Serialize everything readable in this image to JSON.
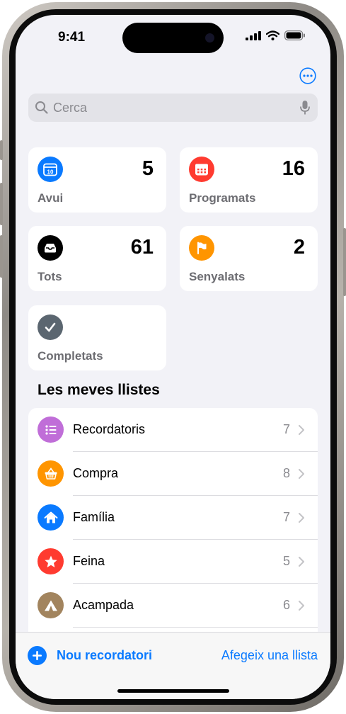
{
  "status_bar": {
    "time": "9:41"
  },
  "search": {
    "placeholder": "Cerca"
  },
  "smart_lists": [
    {
      "label": "Avui",
      "count": "5",
      "color": "#0a7aff",
      "icon": "calendar-today-icon"
    },
    {
      "label": "Programats",
      "count": "16",
      "color": "#ff3b30",
      "icon": "calendar-icon"
    },
    {
      "label": "Tots",
      "count": "61",
      "color": "#000000",
      "icon": "tray-icon"
    },
    {
      "label": "Senyalats",
      "count": "2",
      "color": "#ff9500",
      "icon": "flag-icon"
    },
    {
      "label": "Completats",
      "count": "",
      "color": "#5b6670",
      "icon": "checkmark-icon"
    }
  ],
  "calendar_day": "10",
  "my_lists_title": "Les meves llistes",
  "lists": [
    {
      "name": "Recordatoris",
      "count": "7",
      "color": "#c06ed8",
      "icon": "list-bullet-icon"
    },
    {
      "name": "Compra",
      "count": "8",
      "color": "#ff9500",
      "icon": "basket-icon"
    },
    {
      "name": "Família",
      "count": "7",
      "color": "#0a7aff",
      "icon": "house-icon"
    },
    {
      "name": "Feina",
      "count": "5",
      "color": "#ff3b30",
      "icon": "star-icon"
    },
    {
      "name": "Acampada",
      "count": "6",
      "color": "#a2845e",
      "icon": "tent-icon"
    }
  ],
  "toolbar": {
    "new_reminder": "Nou recordatori",
    "add_list": "Afegeix una llista"
  },
  "accent_color": "#0a7aff"
}
